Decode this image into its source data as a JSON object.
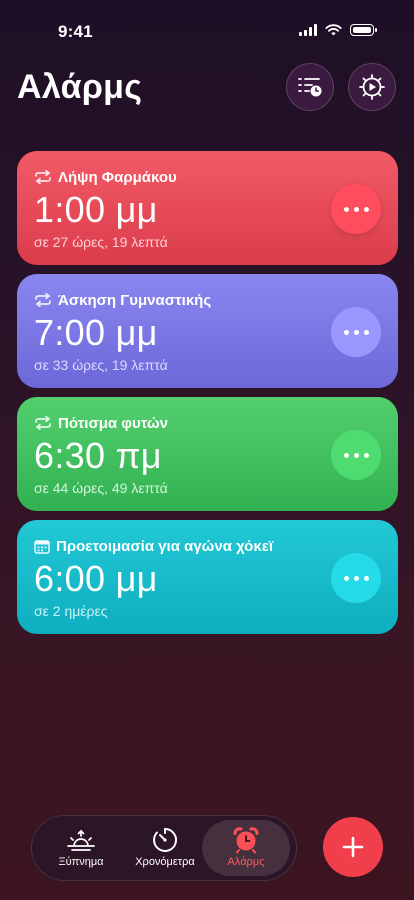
{
  "status_bar": {
    "time": "9:41"
  },
  "header": {
    "title": "Αλάρμς"
  },
  "alarms": [
    {
      "title": "Λήψη Φαρμάκου",
      "time": "1:00 μμ",
      "subtitle": "σε 27 ώρες, 19 λεπτά",
      "icon": "repeat-icon",
      "color": "#e84a58"
    },
    {
      "title": "Άσκηση Γυμναστικής",
      "time": "7:00 μμ",
      "subtitle": "σε 33 ώρες, 19 λεπτά",
      "icon": "repeat-icon",
      "color": "#7b77e6"
    },
    {
      "title": "Πότισμα φυτών",
      "time": "6:30 πμ",
      "subtitle": "σε 44 ώρες, 49 λεπτά",
      "icon": "repeat-icon",
      "color": "#42c060"
    },
    {
      "title": "Προετοιμασία για αγώνα χόκεϊ",
      "time": "6:00 μμ",
      "subtitle": "σε 2 ημέρες",
      "icon": "calendar-icon",
      "color": "#18bccb"
    }
  ],
  "tabbar": {
    "items": [
      {
        "label": "Ξύπνημα",
        "icon": "sunrise-icon"
      },
      {
        "label": "Χρονόμετρα",
        "icon": "timer-icon"
      },
      {
        "label": "Αλάρμς",
        "icon": "alarm-clock-icon",
        "selected": true
      }
    ]
  },
  "accent": "#f03e4a"
}
